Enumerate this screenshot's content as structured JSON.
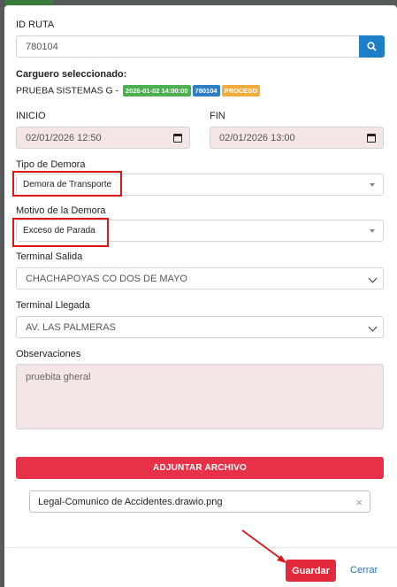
{
  "form": {
    "route_id_label": "ID RUTA",
    "route_id_value": "780104",
    "carrier_label": "Carguero seleccionado:",
    "carrier_name": "PRUEBA SISTEMAS G -",
    "badges": [
      {
        "text": "2026-01-02 14:00:00",
        "color": "#4caf50"
      },
      {
        "text": "780104",
        "color": "#2f7fc7"
      },
      {
        "text": "PROCESO",
        "color": "#f0ad3e"
      }
    ],
    "start_label": "INICIO",
    "start_value": "02/01/2026 12:50",
    "end_label": "FIN",
    "end_value": "02/01/2026 13:00",
    "delay_type_label": "Tipo de Demora",
    "delay_type_value": "Demora de Transporte",
    "delay_reason_label": "Motivo de la Demora",
    "delay_reason_value": "Exceso de Parada",
    "departure_label": "Terminal Salida",
    "departure_value": "CHACHAPOYAS CO DOS DE MAYO",
    "arrival_label": "Terminal Llegada",
    "arrival_value": "AV. LAS PALMERAS",
    "notes_label": "Observaciones",
    "notes_value": "pruebita gheral",
    "attach_label": "ADJUNTAR ARCHIVO",
    "file_name": "Legal-Comunico de Accidentes.drawio.png",
    "file_remove": "×"
  },
  "footer": {
    "save_label": "Guardar",
    "close_label": "Cerrar"
  },
  "colors": {
    "primary": "#1e7fc9",
    "danger": "#e4293c",
    "annotation": "#e01515"
  }
}
